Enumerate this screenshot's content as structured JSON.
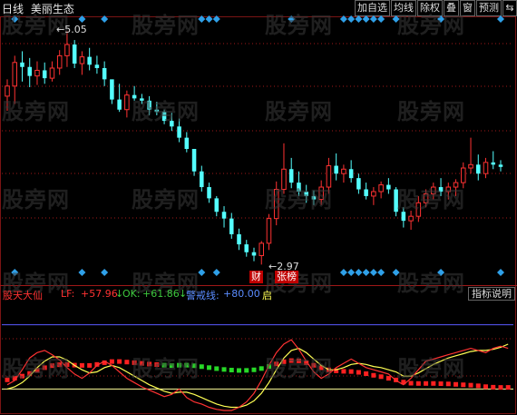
{
  "header": {
    "period": "日线",
    "stock_name": "美丽生态",
    "buttons": [
      {
        "label": "加自选",
        "name": "add-watchlist-button"
      },
      {
        "label": "均线",
        "name": "moving-average-button"
      },
      {
        "label": "除权",
        "name": "ex-rights-button"
      },
      {
        "label": "叠",
        "name": "overlay-button"
      },
      {
        "label": "窗",
        "name": "window-button"
      },
      {
        "label": "预测",
        "name": "forecast-button"
      }
    ],
    "nav_icon": "left-right-arrows-icon"
  },
  "price_chart": {
    "high_label": "5.05",
    "low_label": "2.97",
    "tags": [
      "财",
      "张榜"
    ]
  },
  "indicator": {
    "name": "股天大仙",
    "lf_label": "LF:",
    "lf_value": "+57.96",
    "ok_arrow": "↓",
    "ok_label": "OK:",
    "ok_value": "+61.86",
    "warn_arrow": "↓",
    "warn_label": "警戒线:",
    "warn_value": "+80.00",
    "cursor_mark": "启",
    "explain_label": "指标说明"
  },
  "watermark": "股旁网",
  "colors": {
    "up": "#ff3232",
    "down": "#54ffff",
    "lf_line": "#ff3232",
    "ok_line": "#ffff54",
    "warn_line": "#5a5aff",
    "accent_diamond": "#2fa0e8"
  },
  "chart_data": {
    "type": "candlestick",
    "candles": [
      [
        4.47,
        4.62,
        4.34,
        4.56
      ],
      [
        4.56,
        4.83,
        4.4,
        4.77
      ],
      [
        4.77,
        4.87,
        4.6,
        4.73
      ],
      [
        4.73,
        4.81,
        4.55,
        4.65
      ],
      [
        4.65,
        4.78,
        4.57,
        4.7
      ],
      [
        4.7,
        4.77,
        4.58,
        4.63
      ],
      [
        4.63,
        4.78,
        4.6,
        4.72
      ],
      [
        4.72,
        4.88,
        4.66,
        4.83
      ],
      [
        4.83,
        5.05,
        4.73,
        4.93
      ],
      [
        4.93,
        4.97,
        4.72,
        4.76
      ],
      [
        4.76,
        4.87,
        4.66,
        4.82
      ],
      [
        4.82,
        4.9,
        4.7,
        4.75
      ],
      [
        4.75,
        4.83,
        4.67,
        4.72
      ],
      [
        4.72,
        4.78,
        4.56,
        4.62
      ],
      [
        4.62,
        4.6,
        4.4,
        4.44
      ],
      [
        4.44,
        4.58,
        4.33,
        4.35
      ],
      [
        4.35,
        4.52,
        4.28,
        4.48
      ],
      [
        4.48,
        4.56,
        4.43,
        4.45
      ],
      [
        4.45,
        4.49,
        4.4,
        4.43
      ],
      [
        4.43,
        4.47,
        4.3,
        4.35
      ],
      [
        4.35,
        4.42,
        4.3,
        4.33
      ],
      [
        4.33,
        4.35,
        4.22,
        4.25
      ],
      [
        4.25,
        4.32,
        4.16,
        4.2
      ],
      [
        4.2,
        4.27,
        4.06,
        4.1
      ],
      [
        4.1,
        4.15,
        3.97,
        4.0
      ],
      [
        4.0,
        3.95,
        3.76,
        3.8
      ],
      [
        3.8,
        3.85,
        3.62,
        3.66
      ],
      [
        3.66,
        3.7,
        3.52,
        3.56
      ],
      [
        3.56,
        3.58,
        3.4,
        3.44
      ],
      [
        3.44,
        3.49,
        3.3,
        3.38
      ],
      [
        3.38,
        3.43,
        3.2,
        3.24
      ],
      [
        3.24,
        3.29,
        3.1,
        3.15
      ],
      [
        3.15,
        3.19,
        3.04,
        3.08
      ],
      [
        3.08,
        3.12,
        3.0,
        3.05
      ],
      [
        3.05,
        3.18,
        2.97,
        3.16
      ],
      [
        3.16,
        3.42,
        3.1,
        3.38
      ],
      [
        3.38,
        3.71,
        3.32,
        3.64
      ],
      [
        3.64,
        4.05,
        3.6,
        3.82
      ],
      [
        3.82,
        3.92,
        3.65,
        3.7
      ],
      [
        3.7,
        3.8,
        3.58,
        3.62
      ],
      [
        3.62,
        3.68,
        3.52,
        3.58
      ],
      [
        3.58,
        3.63,
        3.5,
        3.55
      ],
      [
        3.55,
        3.72,
        3.5,
        3.66
      ],
      [
        3.66,
        3.92,
        3.6,
        3.85
      ],
      [
        3.85,
        3.96,
        3.72,
        3.78
      ],
      [
        3.78,
        3.86,
        3.7,
        3.82
      ],
      [
        3.82,
        3.9,
        3.7,
        3.74
      ],
      [
        3.74,
        3.78,
        3.6,
        3.64
      ],
      [
        3.64,
        3.7,
        3.55,
        3.58
      ],
      [
        3.58,
        3.66,
        3.5,
        3.62
      ],
      [
        3.62,
        3.71,
        3.56,
        3.68
      ],
      [
        3.68,
        3.74,
        3.6,
        3.64
      ],
      [
        3.64,
        3.66,
        3.4,
        3.44
      ],
      [
        3.44,
        3.48,
        3.3,
        3.36
      ],
      [
        3.36,
        3.45,
        3.28,
        3.4
      ],
      [
        3.4,
        3.58,
        3.35,
        3.52
      ],
      [
        3.52,
        3.64,
        3.48,
        3.6
      ],
      [
        3.6,
        3.7,
        3.55,
        3.66
      ],
      [
        3.66,
        3.74,
        3.58,
        3.62
      ],
      [
        3.62,
        3.7,
        3.55,
        3.66
      ],
      [
        3.66,
        3.73,
        3.58,
        3.7
      ],
      [
        3.7,
        3.88,
        3.65,
        3.83
      ],
      [
        3.83,
        4.1,
        3.78,
        3.86
      ],
      [
        3.86,
        3.95,
        3.72,
        3.78
      ],
      [
        3.78,
        3.92,
        3.74,
        3.88
      ],
      [
        3.88,
        3.98,
        3.82,
        3.86
      ],
      [
        3.86,
        3.9,
        3.8,
        3.84
      ]
    ],
    "lf": [
      24,
      28,
      38,
      49,
      54,
      56,
      52,
      47,
      40,
      34,
      30,
      35,
      42,
      46,
      42,
      36,
      30,
      26,
      22,
      19,
      16,
      13,
      15,
      20,
      12,
      8,
      6,
      3,
      1,
      0,
      0,
      3,
      8,
      16,
      28,
      42,
      54,
      62,
      66,
      57,
      46,
      36,
      30,
      34,
      40,
      44,
      48,
      44,
      40,
      38,
      36,
      34,
      28,
      24,
      30,
      38,
      46,
      48,
      50,
      52,
      54,
      56,
      58,
      56,
      54,
      58,
      60,
      57.96
    ],
    "ok": [
      20,
      22,
      26,
      32,
      40,
      46,
      50,
      50,
      47,
      42,
      38,
      35,
      36,
      40,
      42,
      40,
      36,
      32,
      28,
      24,
      21,
      18,
      16,
      17,
      17,
      15,
      12,
      9,
      6,
      4,
      3,
      3,
      5,
      9,
      16,
      26,
      38,
      49,
      56,
      58,
      54,
      48,
      42,
      38,
      38,
      40,
      43,
      44,
      43,
      41,
      40,
      38,
      36,
      32,
      32,
      35,
      39,
      43,
      46,
      49,
      51,
      53,
      55,
      56,
      56,
      57,
      59,
      61.86
    ],
    "warn": 80,
    "ylim": [
      0,
      100
    ]
  }
}
